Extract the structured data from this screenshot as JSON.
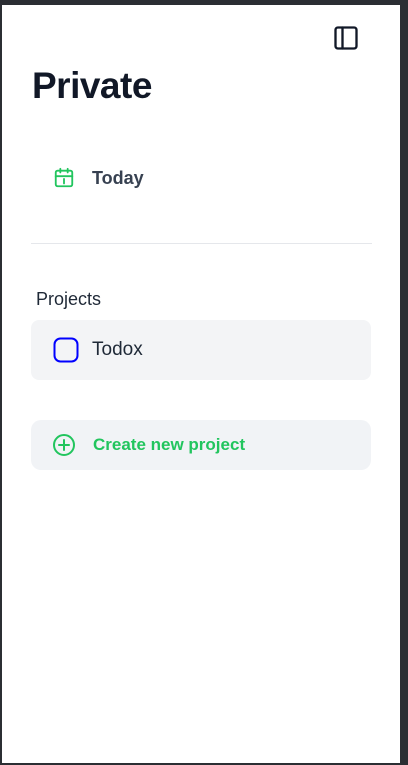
{
  "sidebar": {
    "title": "Private",
    "toggle_icon": "sidebar-panel-icon",
    "nav": [
      {
        "label": "Today",
        "icon": "calendar-icon",
        "icon_color": "#22c55e"
      }
    ],
    "projects_heading": "Projects",
    "projects": [
      {
        "label": "Todox",
        "icon": "rounded-square-icon",
        "icon_color": "#0000ff"
      }
    ],
    "create_project": {
      "label": "Create new project",
      "icon": "plus-circle-icon",
      "color": "#22c55e"
    }
  }
}
